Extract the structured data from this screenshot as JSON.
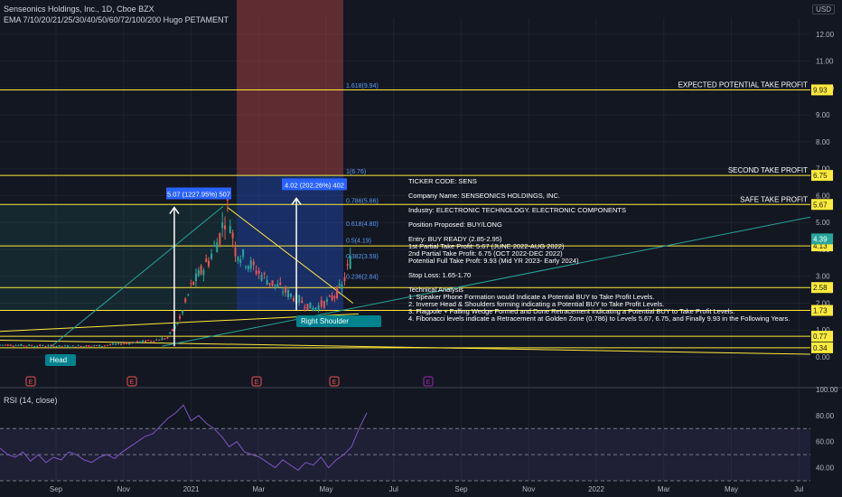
{
  "header": {
    "title": "Senseonics Holdings, Inc., 1D, Cboe BZX",
    "indicator": "EMA 7/10/20/21/25/30/40/50/60/72/100/200 Hugo PETAMENT"
  },
  "currency": "USD",
  "rsi_label": "RSI (14, close)",
  "colors": {
    "bg": "#131722",
    "grid": "#1e222d",
    "up": "#26a69a",
    "down": "#ef5350",
    "level": "#ffeb3b",
    "rsi": "#7e57c2"
  },
  "chart_data": [
    {
      "type": "candlestick",
      "title": "Senseonics Holdings, Inc., 1D, Cboe BZX",
      "ylim": [
        0,
        12.6
      ],
      "y_ticks": [
        "12.00",
        "11.00",
        "10.00",
        "9.00",
        "8.00",
        "7.00",
        "6.00",
        "5.00",
        "4.00",
        "3.00",
        "2.00",
        "1.00",
        "0.00"
      ],
      "x_ticks": [
        "Sep",
        "Nov",
        "2021",
        "Mar",
        "May",
        "Jul",
        "Sep",
        "Nov",
        "2022",
        "Mar",
        "May",
        "Jul"
      ],
      "x_tick_index": [
        0,
        2,
        4,
        6,
        8,
        10,
        12,
        14,
        16,
        18,
        20,
        22
      ],
      "price_path": [
        [
          "2020-08-01",
          0.45
        ],
        [
          "2020-09-01",
          0.42
        ],
        [
          "2020-10-01",
          0.4
        ],
        [
          "2020-11-01",
          0.42
        ],
        [
          "2020-12-15",
          0.6
        ],
        [
          "2020-12-30",
          0.7
        ],
        [
          "2021-01-10",
          1.4
        ],
        [
          "2021-01-20",
          2.6
        ],
        [
          "2021-02-05",
          3.6
        ],
        [
          "2021-02-15",
          4.5
        ],
        [
          "2021-02-22",
          5.56
        ],
        [
          "2021-03-01",
          4.0
        ],
        [
          "2021-03-15",
          3.4
        ],
        [
          "2021-04-01",
          2.8
        ],
        [
          "2021-04-20",
          2.3
        ],
        [
          "2021-05-10",
          1.8
        ],
        [
          "2021-05-25",
          2.1
        ],
        [
          "2021-06-05",
          2.6
        ],
        [
          "2021-06-15",
          3.9
        ]
      ],
      "levels": [
        {
          "value": 9.93,
          "label": "EXPECTED POTENTIAL TAKE PROFIT"
        },
        {
          "value": 6.75,
          "label": "SECOND TAKE PROFIT"
        },
        {
          "value": 5.67,
          "label": "SAFE TAKE PROFIT"
        },
        {
          "value": 4.13,
          "label": ""
        },
        {
          "value": 2.58,
          "label": ""
        },
        {
          "value": 1.73,
          "label": ""
        },
        {
          "value": 0.77,
          "label": ""
        },
        {
          "value": 0.34,
          "label": ""
        }
      ],
      "last_price": 4.39,
      "fib_levels": [
        {
          "label": "1.618(9.94)",
          "value": 9.94
        },
        {
          "label": "1(6.76)",
          "value": 6.76
        },
        {
          "label": "0.786(5.66)",
          "value": 5.66
        },
        {
          "label": "0.618(4.80)",
          "value": 4.8
        },
        {
          "label": "0.5(4.19)",
          "value": 4.19
        },
        {
          "label": "0.382(3.59)",
          "value": 3.59
        },
        {
          "label": "0.236(2.84)",
          "value": 2.84
        }
      ],
      "annotations": {
        "pattern_labels": [
          "Head",
          "Right Shoulder"
        ],
        "measure_left": "5.07 (1227.95%) 507",
        "measure_right": "4.02 (202.26%) 402",
        "event_markers": [
          "E",
          "E",
          "E",
          "E",
          "E"
        ]
      },
      "analysis_text": [
        "TICKER CODE: SENS",
        "Company Name: SENSEONICS HOLDINGS, INC.",
        "Industry: ELECTRONIC TECHNOLOGY. ELECTRONIC COMPONENTS",
        "Position Proposed: BUY/LONG",
        "Entry: BUY READY (2.85-2.95)",
        "1st Partial Take Profit: 5.67 (JUNE 2022-AUG 2022)",
        "2nd Partial Take Profit: 6.75 (OCT 2022-DEC 2022)",
        "Potential Full Take Proft: 9.93 (Mid YR 2023- Early 2024)",
        "Stop Loss: 1.65-1.70",
        "Technical Analysis",
        "1. Speaker Phone Formation would Indicate a Potential BUY to Take Profit Levels.",
        "2. Inverse Head & Shoulders forming indicating a Potential BUY to Take Profit Levels.",
        "3. Flagpole + Falling Wedge Formed and Done Retracement indicating a Potential BUY to Take Profit Levels.",
        "4. Fibonacci levels indicate a Retracement at Golden Zone (0.786) to Levels 5.67, 6.75, and Finally 9.93 in the Following Years."
      ]
    },
    {
      "type": "line",
      "title": "RSI (14, close)",
      "ylim": [
        30,
        102
      ],
      "y_ticks": [
        "100.00",
        "80.00",
        "60.00",
        "40.00"
      ],
      "bands": [
        70,
        50,
        30
      ],
      "values": [
        55,
        50,
        48,
        52,
        45,
        50,
        44,
        48,
        46,
        52,
        50,
        46,
        44,
        48,
        50,
        47,
        52,
        56,
        60,
        64,
        66,
        72,
        78,
        82,
        88,
        76,
        80,
        74,
        70,
        64,
        56,
        60,
        52,
        50,
        48,
        44,
        40,
        46,
        42,
        38,
        44,
        42,
        48,
        40,
        46,
        50,
        56,
        70,
        82
      ]
    }
  ]
}
